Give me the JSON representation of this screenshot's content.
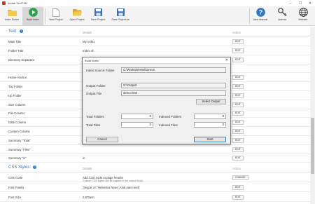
{
  "window": {
    "title": "Arclab DirHTML"
  },
  "toolbar": {
    "index_folder": "Index Folder",
    "build_index": "Build Index",
    "new_project": "New Project",
    "open_project": "Open Project",
    "save_project": "Save Project",
    "save_project_as": "Save Project As",
    "user_manual": "User Manual",
    "license": "License",
    "website": "Website"
  },
  "text_section": {
    "title": "Text:",
    "details_header": "Details",
    "action_header": "Action",
    "rows": [
      {
        "label": "Main Title",
        "detail": "My Index",
        "action": "EDIT"
      },
      {
        "label": "Folder Title",
        "detail": "Index of:",
        "action": "EDIT"
      },
      {
        "label": "Directory Separator",
        "detail": "",
        "action": "EDIT"
      },
      {
        "label": "",
        "detail": "",
        "action": ""
      },
      {
        "label": "Home Anchor",
        "detail": "",
        "action": "EDIT"
      },
      {
        "label": "Top Folder",
        "detail": "",
        "action": "EDIT"
      },
      {
        "label": "Up Folder",
        "detail": "",
        "action": "EDIT"
      },
      {
        "label": "Size Column",
        "detail": "",
        "action": "EDIT"
      },
      {
        "label": "File Column",
        "detail": "",
        "action": "EDIT"
      },
      {
        "label": "Date Column",
        "detail": "",
        "action": "EDIT"
      },
      {
        "label": "Custom Column",
        "detail": "",
        "action": "EDIT"
      },
      {
        "label": "Summary \"Total\"",
        "detail": "",
        "action": "EDIT"
      },
      {
        "label": "Summary \"Files\"",
        "detail": "",
        "action": "EDIT"
      },
      {
        "label": "Summary \"in\"",
        "detail": "in",
        "action": "EDIT"
      }
    ]
  },
  "css_section": {
    "title": "CSS Styles:",
    "details_header": "Details",
    "action_header": "Action",
    "rows": [
      {
        "label": "CSS Code",
        "detail": "Add CSS code to page header",
        "detail2": "Custom CSS styles can be applied in the output file(s).",
        "action": "CHANGE"
      },
      {
        "label": "Font Family",
        "detail": "'Segoe UI','Helvetica Neue',Arial,sans-serif",
        "detail2": "",
        "action": "EDIT"
      },
      {
        "label": "Font Size",
        "detail": "0.875em",
        "detail2": "",
        "action": "EDIT"
      }
    ]
  },
  "dialog": {
    "title": "Build Index",
    "close": "✕",
    "index_source_label": "Index Source Folder",
    "index_source_value": "C:\\WorkIdx\\Html\\Demo\\",
    "output_folder_label": "Output Folder",
    "output_folder_value": "G:\\Output\\",
    "output_file_label": "Output File",
    "output_file_value": "demo.html",
    "select_output": "Select Output",
    "total_folders_label": "Total Folders",
    "total_folders_value": "0",
    "indexed_folders_label": "Indexed Folders",
    "indexed_folders_value": "0",
    "total_files_label": "Total Files",
    "total_files_value": "0",
    "indexed_files_label": "Indexed Files",
    "indexed_files_value": "0",
    "cancel": "Cancel",
    "start": "Start"
  },
  "colors": {
    "accent": "#2e78c7",
    "build_green": "#2e9e4a"
  }
}
